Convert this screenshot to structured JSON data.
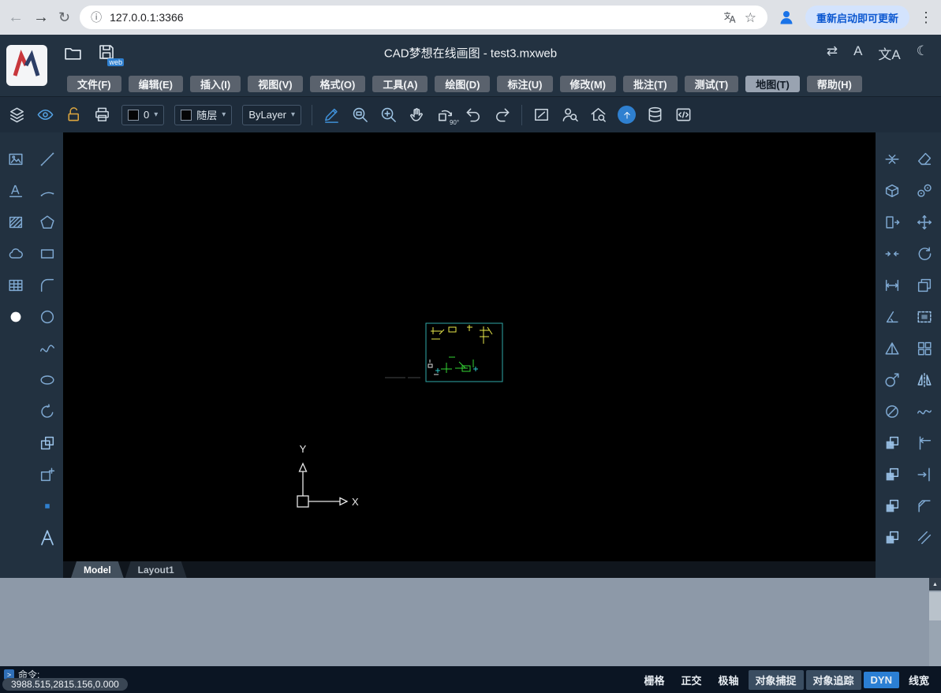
{
  "browser": {
    "url": "127.0.0.1:3366",
    "update_button": "重新启动即可更新"
  },
  "header": {
    "title": "CAD梦想在线画图 - test3.mxweb",
    "web_badge": "web"
  },
  "menus": [
    {
      "label": "文件(F)"
    },
    {
      "label": "编辑(E)"
    },
    {
      "label": "插入(I)"
    },
    {
      "label": "视图(V)"
    },
    {
      "label": "格式(O)"
    },
    {
      "label": "工具(A)"
    },
    {
      "label": "绘图(D)"
    },
    {
      "label": "标注(U)"
    },
    {
      "label": "修改(M)"
    },
    {
      "label": "批注(T)"
    },
    {
      "label": "测试(T)"
    },
    {
      "label": "地图(T)"
    },
    {
      "label": "帮助(H)"
    }
  ],
  "toolbar": {
    "layer_value": "0",
    "color_value": "随层",
    "linetype_value": "ByLayer",
    "rotate_label": "90°"
  },
  "canvas": {
    "tabs": [
      {
        "label": "Model"
      },
      {
        "label": "Layout1"
      }
    ],
    "ucs": {
      "x_label": "X",
      "y_label": "Y"
    }
  },
  "command": {
    "prompt": "命令:",
    "coordinates": "3988.515,2815.156,0.000"
  },
  "status_toggles": [
    {
      "label": "栅格",
      "state": "off"
    },
    {
      "label": "正交",
      "state": "off"
    },
    {
      "label": "极轴",
      "state": "off"
    },
    {
      "label": "对象捕捉",
      "state": "on"
    },
    {
      "label": "对象追踪",
      "state": "on"
    },
    {
      "label": "DYN",
      "state": "active"
    },
    {
      "label": "线宽",
      "state": "off"
    }
  ],
  "icons": {
    "back": "←",
    "forward": "→",
    "reload": "↻",
    "info": "ⓘ",
    "star": "☆",
    "menu_dots": "⋮",
    "swap": "⇄",
    "ai": "A",
    "translate_ab": "文A",
    "moon": "☾",
    "caret": "▾",
    "prompt": ">",
    "scroll_up": "▲"
  },
  "colors": {
    "accent_blue": "#2b7fd4",
    "panel_bg": "#223140",
    "canvas_bg": "#000000",
    "history_bg": "#8d99a8",
    "drawing_teal": "#2fa8a8",
    "drawing_yellow": "#e8e84a",
    "drawing_green": "#35d435"
  },
  "tool_icons": {
    "left": [
      "insert-image",
      "line",
      "text-style",
      "arc",
      "hatch",
      "polygon",
      "revision-cloud",
      "rectangle",
      "table",
      "fillet",
      "point-style",
      "circle",
      "spline",
      "ellipse",
      "arc-arrow",
      "insert-block",
      "create-block",
      "point",
      "text"
    ],
    "right": [
      "align",
      "erase",
      "box-3d",
      "divide",
      "stretch",
      "move",
      "break",
      "rotate",
      "measure",
      "copy",
      "angle",
      "select-window",
      "area",
      "array",
      "scale",
      "mirror",
      "diameter",
      "spline-edit",
      "layer-copy",
      "trim",
      "layer-move",
      "extend",
      "layer-paste",
      "chamfer",
      "layer-merge",
      "offset"
    ]
  }
}
